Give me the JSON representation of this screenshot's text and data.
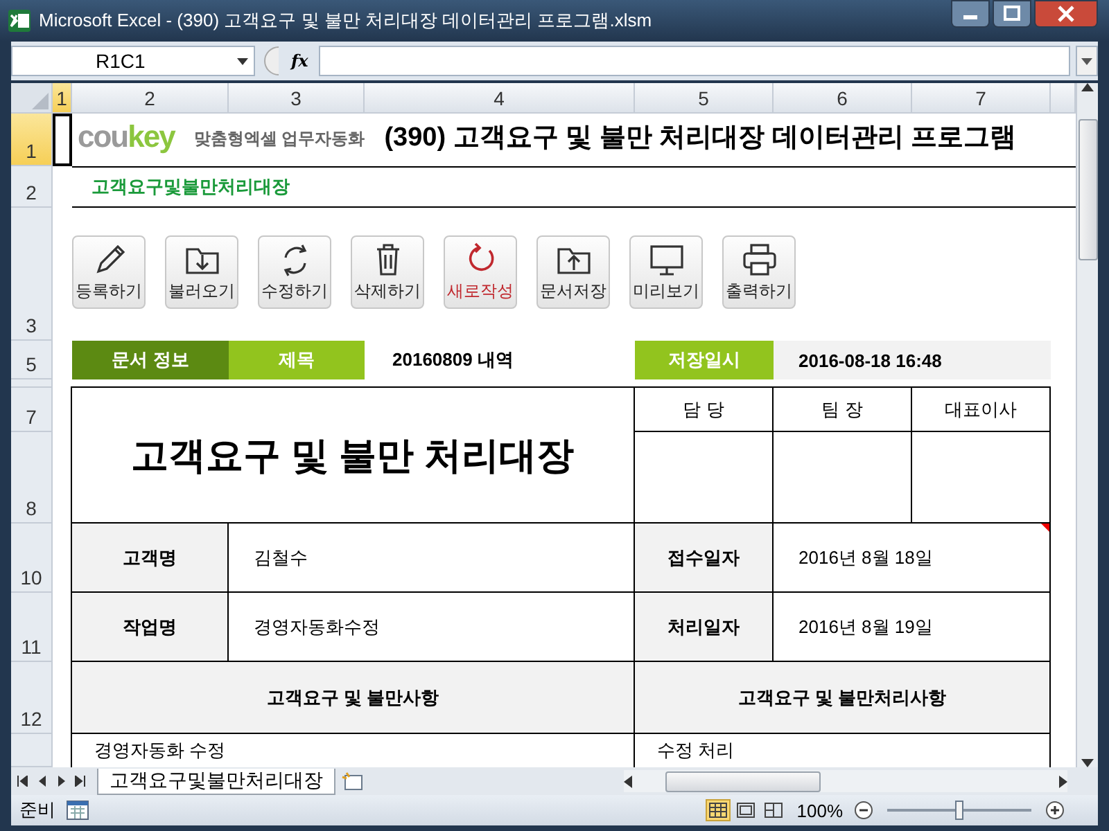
{
  "window": {
    "title": "Microsoft Excel - (390) 고객요구 및 불만 처리대장 데이터관리 프로그램.xlsm"
  },
  "formula_bar": {
    "name_box": "R1C1",
    "function_button": "fx"
  },
  "column_headers": [
    {
      "label": "1",
      "selected": true
    },
    {
      "label": "2",
      "selected": false
    },
    {
      "label": "3",
      "selected": false
    },
    {
      "label": "4",
      "selected": false
    },
    {
      "label": "5",
      "selected": false
    },
    {
      "label": "6",
      "selected": false
    },
    {
      "label": "7",
      "selected": false
    }
  ],
  "row_headers": [
    {
      "label": "1",
      "selected": true
    },
    {
      "label": "2",
      "selected": false
    },
    {
      "label": "3",
      "selected": false
    },
    {
      "label": "5",
      "selected": false
    },
    {
      "label": "7",
      "selected": false
    },
    {
      "label": "8",
      "selected": false
    },
    {
      "label": "10",
      "selected": false
    },
    {
      "label": "11",
      "selected": false
    },
    {
      "label": "12",
      "selected": false
    }
  ],
  "logo": {
    "wordmark": [
      "cou",
      "key"
    ],
    "tagline": "맞춤형엑셀 업무자동화"
  },
  "heading": "(390) 고객요구 및 불만 처리대장 데이터관리 프로그램",
  "subtitle": "고객요구및불만처리대장",
  "toolbar": [
    {
      "label": "등록하기",
      "kind": "pencil",
      "highlighted": false
    },
    {
      "label": "불러오기",
      "kind": "folder-down",
      "highlighted": false
    },
    {
      "label": "수정하기",
      "kind": "cycle",
      "highlighted": false
    },
    {
      "label": "삭제하기",
      "kind": "trash",
      "highlighted": false
    },
    {
      "label": "새로작성",
      "kind": "refresh",
      "highlighted": true
    },
    {
      "label": "문서저장",
      "kind": "folder-up",
      "highlighted": false
    },
    {
      "label": "미리보기",
      "kind": "monitor",
      "highlighted": false
    },
    {
      "label": "출력하기",
      "kind": "printer",
      "highlighted": false
    }
  ],
  "info_bar": {
    "section_label": "문서 정보",
    "title_label": "제목",
    "title_value": "20160809 내역",
    "saved_label": "저장일시",
    "saved_value": "2016-08-18 16:48"
  },
  "form": {
    "title": "고객요구 및 불만 처리대장",
    "approvals": [
      "담 당",
      "팀 장",
      "대표이사"
    ],
    "fields": [
      {
        "label": "고객명",
        "value": "김철수",
        "label_2": "접수일자",
        "value_2": "2016년 8월 18일"
      },
      {
        "label": "작업명",
        "value": "경영자동화수정",
        "label_2": "처리일자",
        "value_2": "2016년 8월 19일"
      }
    ],
    "sections": [
      {
        "heading": "고객요구 및 불만사항",
        "content": "경영자동화 수정"
      },
      {
        "heading": "고객요구 및 불만처리사항",
        "content": "수정 처리"
      }
    ]
  },
  "sheet_tabs": [
    {
      "label": "고객요구및불만처리대장",
      "selected": true
    }
  ],
  "status_bar": {
    "mode": "준비",
    "views": [
      {
        "kind": "normal",
        "selected": true
      },
      {
        "kind": "layout",
        "selected": false
      },
      {
        "kind": "break",
        "selected": false
      }
    ],
    "zoom": "100%",
    "zoom_slider": {
      "level": 0.5
    }
  }
}
